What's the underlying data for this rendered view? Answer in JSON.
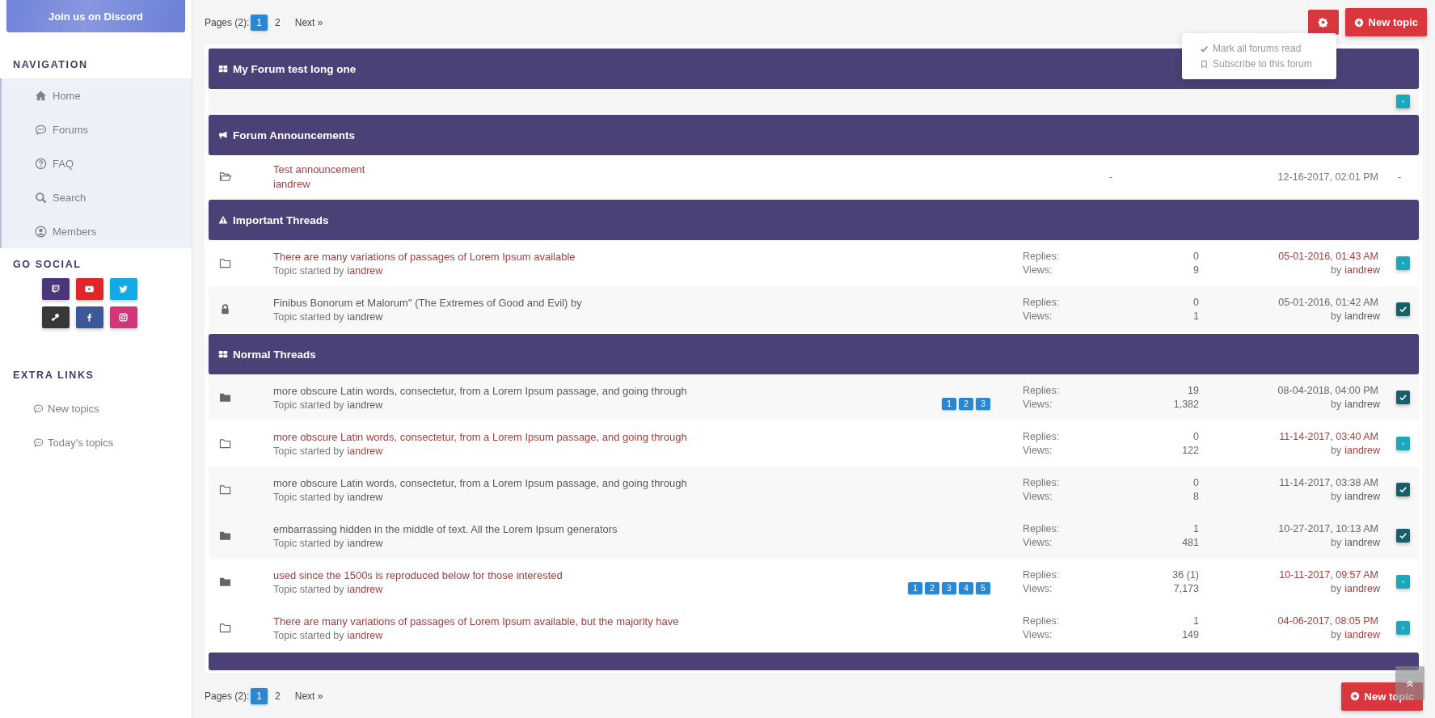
{
  "sidebar": {
    "discord_button": "Join us on Discord",
    "navigation": {
      "heading": "NAVIGATION",
      "items": [
        {
          "label": "Home",
          "kind": "home"
        },
        {
          "label": "Forums",
          "kind": "chat"
        },
        {
          "label": "FAQ",
          "kind": "question"
        },
        {
          "label": "Search",
          "kind": "search"
        },
        {
          "label": "Members",
          "kind": "user"
        }
      ]
    },
    "social": {
      "heading": "GO SOCIAL",
      "buttons": [
        {
          "kind": "twitch",
          "color": "#4b367c"
        },
        {
          "kind": "youtube",
          "color": "#e0262a"
        },
        {
          "kind": "twitter",
          "color": "#12a9e6"
        },
        {
          "kind": "steam",
          "color": "#383838"
        },
        {
          "kind": "facebook",
          "color": "#3b5998"
        },
        {
          "kind": "instagram",
          "color": "#d1357a"
        }
      ]
    },
    "extra_links": {
      "heading": "EXTRA LINKS",
      "items": [
        {
          "label": "New topics",
          "kind": "chat"
        },
        {
          "label": "Today's topics",
          "kind": "chat"
        }
      ]
    }
  },
  "top_pagination": {
    "label": "Pages (2):",
    "pages": [
      {
        "label": "1",
        "selected": true
      },
      {
        "label": "2",
        "selected": false
      }
    ],
    "next": "Next »"
  },
  "settings_menu": {
    "expanded": true,
    "items": [
      {
        "kind": "check",
        "label": "Mark all forums read"
      },
      {
        "kind": "bookmark",
        "label": "Subscribe to this forum"
      }
    ]
  },
  "new_topic_button": "New topic",
  "sections": [
    {
      "kind": "grid",
      "title": "My Forum test long one",
      "rows": [
        {
          "kind": "marker",
          "checked": false
        }
      ]
    },
    {
      "kind": "bullhorn",
      "title": "Forum Announcements",
      "rows": [
        {
          "kind": "announcement",
          "title": "Test announcement",
          "author": "iandrew",
          "column_3": "-",
          "date": "12-16-2017, 02:01 PM",
          "column_5": "-"
        }
      ]
    },
    {
      "kind": "warning",
      "title": "Important Threads",
      "rows": [
        {
          "kind": "folder",
          "unread": true,
          "title": "There are many variations of passages of Lorem Ipsum available",
          "started_by": "Topic started by",
          "author": "iandrew",
          "replies_label": "Replies:",
          "replies": "0",
          "views_label": "Views:",
          "views": "9",
          "date": "05-01-2016, 01:43 AM",
          "by": "by",
          "last_author": "iandrew",
          "checked": false
        },
        {
          "kind": "lock",
          "unread": false,
          "title": "Finibus Bonorum et Malorum\" (The Extremes of Good and Evil) by",
          "started_by": "Topic started by",
          "author": "iandrew",
          "replies_label": "Replies:",
          "replies": "0",
          "views_label": "Views:",
          "views": "1",
          "date": "05-01-2016, 01:42 AM",
          "by": "by",
          "last_author": "iandrew",
          "checked": true
        }
      ]
    },
    {
      "kind": "grid",
      "title": "Normal Threads",
      "rows": [
        {
          "kind": "folder-filled",
          "unread": false,
          "title": "more obscure Latin words, consectetur, from a Lorem Ipsum passage, and going through",
          "started_by": "Topic started by",
          "author": "iandrew",
          "pages": [
            "1",
            "2",
            "3"
          ],
          "replies_label": "Replies:",
          "replies": "19",
          "views_label": "Views:",
          "views": "1,382",
          "date": "08-04-2018, 04:00 PM",
          "by": "by",
          "last_author": "iandrew",
          "checked": true
        },
        {
          "kind": "folder",
          "unread": true,
          "title": "more obscure Latin words, consectetur, from a Lorem Ipsum passage, and going through",
          "started_by": "Topic started by",
          "author": "iandrew",
          "replies_label": "Replies:",
          "replies": "0",
          "views_label": "Views:",
          "views": "122",
          "date": "11-14-2017, 03:40 AM",
          "by": "by",
          "last_author": "iandrew",
          "checked": false
        },
        {
          "kind": "folder",
          "unread": false,
          "title": "more obscure Latin words, consectetur, from a Lorem Ipsum passage, and going through",
          "started_by": "Topic started by",
          "author": "iandrew",
          "replies_label": "Replies:",
          "replies": "0",
          "views_label": "Views:",
          "views": "8",
          "date": "11-14-2017, 03:38 AM",
          "by": "by",
          "last_author": "iandrew",
          "checked": true
        },
        {
          "kind": "folder-filled",
          "unread": false,
          "title": "embarrassing hidden in the middle of text. All the Lorem Ipsum generators",
          "started_by": "Topic started by",
          "author": "iandrew",
          "replies_label": "Replies:",
          "replies": "1",
          "views_label": "Views:",
          "views": "481",
          "date": "10-27-2017, 10:13 AM",
          "by": "by",
          "last_author": "iandrew",
          "checked": true
        },
        {
          "kind": "folder-filled",
          "unread": true,
          "title": "used since the 1500s is reproduced below for those interested",
          "started_by": "Topic started by",
          "author": "iandrew",
          "pages": [
            "1",
            "2",
            "3",
            "4",
            "5"
          ],
          "replies_label": "Replies:",
          "replies": "36 (1)",
          "views_label": "Views:",
          "views": "7,173",
          "date": "10-11-2017, 09:57 AM",
          "by": "by",
          "last_author": "iandrew",
          "checked": false
        },
        {
          "kind": "folder",
          "unread": true,
          "title": "There are many variations of passages of Lorem Ipsum available, but the majority have",
          "started_by": "Topic started by",
          "author": "iandrew",
          "replies_label": "Replies:",
          "replies": "1",
          "views_label": "Views:",
          "views": "149",
          "date": "04-06-2017, 08:05 PM",
          "by": "by",
          "last_author": "iandrew",
          "checked": false
        }
      ]
    }
  ],
  "bottom_pagination": {
    "label": "Pages (2):",
    "pages": [
      {
        "label": "1",
        "selected": true
      },
      {
        "label": "2",
        "selected": false
      }
    ],
    "next": "Next »"
  },
  "bottom_new_topic_button": "New topic"
}
